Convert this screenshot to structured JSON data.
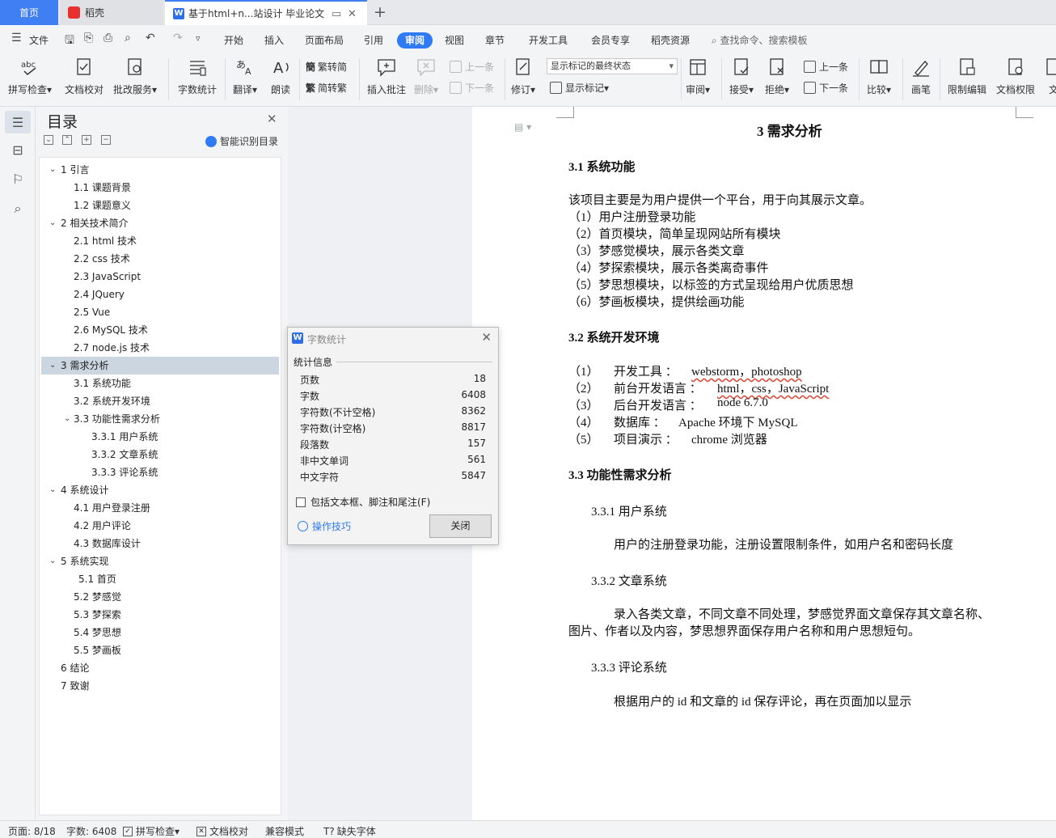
{
  "tabs": {
    "home": "首页",
    "daoke": "稻壳",
    "doc": "基于html+n...站设计 毕业论文"
  },
  "menu": {
    "file": "文件",
    "items": [
      "开始",
      "插入",
      "页面布局",
      "引用",
      "审阅",
      "视图",
      "章节",
      "开发工具",
      "会员专享",
      "稻壳资源"
    ],
    "active": "审阅",
    "search": "查找命令、搜索模板"
  },
  "ribbon": {
    "spell": "拼写检查",
    "proof": "文档校对",
    "batch": "批改服务",
    "wordcount": "字数统计",
    "translate": "翻译",
    "read": "朗读",
    "trad": "繁转简",
    "simp": "简转繁",
    "insert_comment": "插入批注",
    "delete": "删除",
    "prev": "上一条",
    "next": "下一条",
    "track": "修订",
    "markup_select": "显示标记的最终状态",
    "show_markup": "显示标记",
    "review": "审阅",
    "accept": "接受",
    "reject": "拒绝",
    "prev2": "上一条",
    "next2": "下一条",
    "compare": "比较",
    "pen": "画笔",
    "restrict": "限制编辑",
    "rights": "文档权限",
    "more": "文"
  },
  "toc": {
    "title": "目录",
    "smart": "智能识别目录",
    "items": [
      {
        "label": "1  引言"
      },
      {
        "label": "1.1  课题背景"
      },
      {
        "label": "1.2  课题意义"
      },
      {
        "label": "2 相关技术简介"
      },
      {
        "label": "2.1 html 技术"
      },
      {
        "label": "2.2 css 技术"
      },
      {
        "label": "2.3 JavaScript"
      },
      {
        "label": "2.4 JQuery"
      },
      {
        "label": "2.5 Vue"
      },
      {
        "label": "2.6 MySQL 技术"
      },
      {
        "label": "2.7 node.js 技术"
      },
      {
        "label": "3 需求分析"
      },
      {
        "label": "3.1  系统功能"
      },
      {
        "label": "3.2  系统开发环境"
      },
      {
        "label": "3.3 功能性需求分析"
      },
      {
        "label": "3.3.1 用户系统"
      },
      {
        "label": "3.3.2  文章系统"
      },
      {
        "label": "3.3.3    评论系统"
      },
      {
        "label": "4  系统设计"
      },
      {
        "label": "4.1  用户登录注册"
      },
      {
        "label": "4.2  用户评论"
      },
      {
        "label": "4.3  数据库设计"
      },
      {
        "label": "5  系统实现"
      },
      {
        "label": "5.1  首页"
      },
      {
        "label": "5.2  梦感觉"
      },
      {
        "label": "5.3  梦探索"
      },
      {
        "label": "5.4 梦思想"
      },
      {
        "label": "5.5 梦画板"
      },
      {
        "label": "6  结论"
      },
      {
        "label": "7  致谢"
      }
    ]
  },
  "dialog": {
    "title": "字数统计",
    "section": "统计信息",
    "stats": [
      {
        "label": "页数",
        "value": "18"
      },
      {
        "label": "字数",
        "value": "6408"
      },
      {
        "label": "字符数(不计空格)",
        "value": "8362"
      },
      {
        "label": "字符数(计空格)",
        "value": "8817"
      },
      {
        "label": "段落数",
        "value": "157"
      },
      {
        "label": "非中文单词",
        "value": "561"
      },
      {
        "label": "中文字符",
        "value": "5847"
      }
    ],
    "include": "包括文本框、脚注和尾注(F)",
    "tips": "操作技巧",
    "close": "关闭"
  },
  "doc": {
    "h1": "3 需求分析",
    "s31": "3.1  系统功能",
    "intro": "该项目主要是为用户提供一个平台，用于向其展示文章。",
    "features": [
      "（1）用户注册登录功能",
      "（2）首页模块，简单呈现网站所有模块",
      "（3）梦感觉模块，展示各类文章",
      "（4）梦探索模块，展示各类离奇事件",
      "（5）梦思想模块，以标签的方式呈现给用户优质思想",
      "（6）梦画板模块，提供绘画功能"
    ],
    "s32": "3.2  系统开发环境",
    "env": [
      {
        "num": "（1）",
        "label": "开发工具  ：",
        "value": "webstorm，photoshop"
      },
      {
        "num": "（2）",
        "label": "前台开发语言  ：",
        "value": "html，css，JavaScript"
      },
      {
        "num": "（3）",
        "label": "后台开发语言  ：",
        "value": "node 6.7.0"
      },
      {
        "num": "（4）",
        "label": "数据库  ：",
        "value": "Apache 环境下 MySQL"
      },
      {
        "num": "（5）",
        "label": "项目演示  ：",
        "value": "chrome 浏览器"
      }
    ],
    "s33": "3.3 功能性需求分析",
    "s331": "3.3.1 用户系统",
    "p331": "用户的注册登录功能，注册设置限制条件，如用户名和密码长度",
    "s332": "3.3.2  文章系统",
    "p332a": "录入各类文章，不同文章不同处理，梦感觉界面文章保存其文章名称、",
    "p332b": "图片、作者以及内容，梦思想界面保存用户名称和用户思想短句。",
    "s333": "3.3.3    评论系统",
    "p333": "根据用户的 id 和文章的 id 保存评论，再在页面加以显示"
  },
  "status": {
    "page": "页面: 8/18",
    "words": "字数: 6408",
    "spell": "拼写检查",
    "proof": "文档校对",
    "compat": "兼容模式",
    "font": "缺失字体"
  },
  "colors": {
    "accent": "#2f7bf5",
    "home_tab": "#3f7ef3",
    "selected_toc": "#ccd6e0"
  }
}
